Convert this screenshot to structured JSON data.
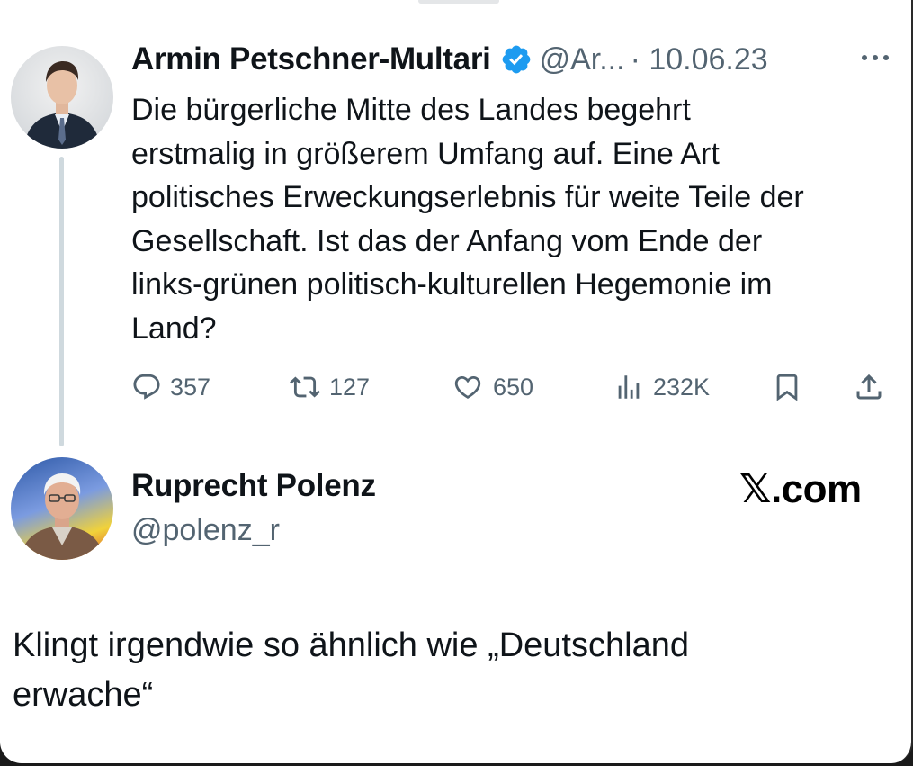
{
  "original_tweet": {
    "author_name": "Armin Petschner-Multari",
    "handle": "@Ar...",
    "date": "· 10.06.23",
    "avatar_icon": "person-avatar-icon",
    "verified_icon": "verified-badge-icon",
    "more_icon": "more-options-icon",
    "text": "Die bürgerliche Mitte des Landes begehrt\nerstmalig in größerem Umfang auf. Eine Art\npolitisches Erweckungserlebnis für weite Teile der\nGesellschaft. Ist das der Anfang vom Ende der\nlinks-grünen politisch-kulturellen Hegemonie im\nLand?",
    "actions": {
      "replies": "357",
      "reposts": "127",
      "likes": "650",
      "views": "232K"
    }
  },
  "reply": {
    "author_name": "Ruprecht Polenz",
    "handle": "@polenz_r",
    "avatar_icon": "person-avatar-icon",
    "text": "Klingt irgendwie so ähnlich wie „Deutschland\nerwache“"
  },
  "watermark": "𝕏.com",
  "colors": {
    "text_primary": "#0f1419",
    "text_secondary": "#536471",
    "verified_blue": "#1d9bf0",
    "thread_line": "#cfd9de"
  }
}
